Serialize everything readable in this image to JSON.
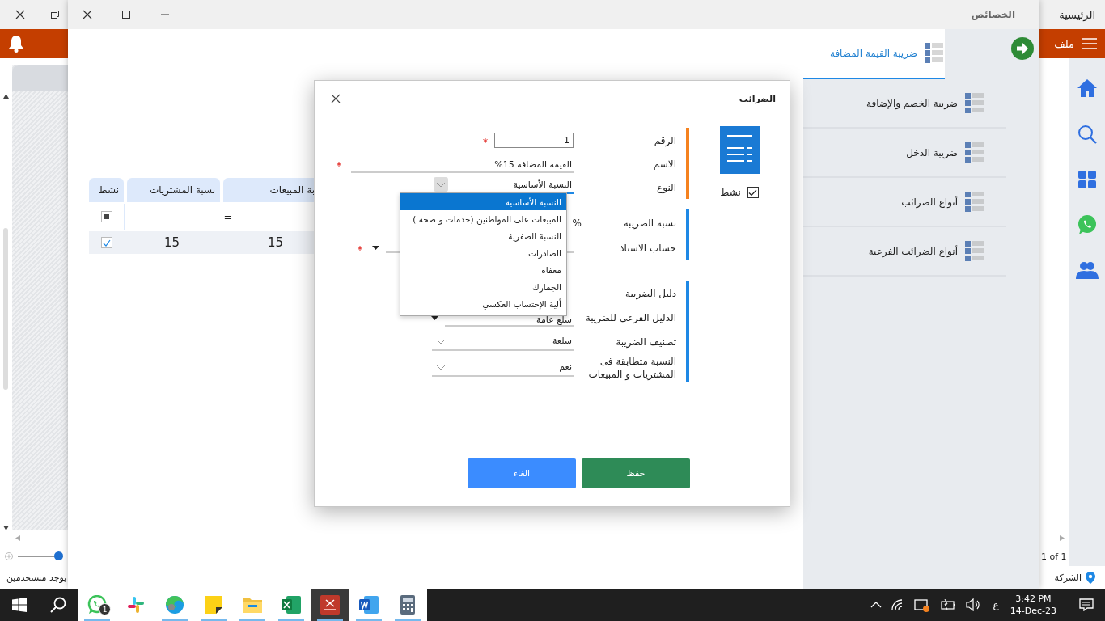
{
  "app": {
    "title": "الرئيسية",
    "menu_label": "ملف",
    "pager": "1 of 1",
    "status_company": "الشركة",
    "status_users": "يوجد مستخدمين",
    "zoom_slider": {
      "level": 0.9
    }
  },
  "properties_window": {
    "title": "الخصائص",
    "nav": [
      {
        "label": "ضريبة القيمة المضافة",
        "selected": true
      },
      {
        "label": "ضريبة الخصم والإضافة",
        "selected": false
      },
      {
        "label": "ضريبة الدخل",
        "selected": false
      },
      {
        "label": "أنواع الضرائب",
        "selected": false
      },
      {
        "label": "أنواع الضرائب الفرعية",
        "selected": false
      }
    ],
    "table": {
      "columns": [
        "بة المبيعات",
        "نسبة المشتريات",
        "نشط"
      ],
      "filter_row": {
        "indeterminate": true,
        "operator": "="
      },
      "rows": [
        {
          "cells": [
            "15",
            "15"
          ],
          "active": true
        }
      ]
    }
  },
  "dialog": {
    "title": "الضرائب",
    "active": true,
    "active_label": "نشط",
    "groups": [
      {
        "color": "#f5821f",
        "fields": [
          {
            "label": "الرقم",
            "kind": "number",
            "value": "1",
            "required": true
          },
          {
            "label": "الاسم",
            "kind": "text",
            "value": "القيمه المضافه 15%",
            "required": true
          },
          {
            "label": "النوع",
            "kind": "select",
            "value": "النسبة الأساسية",
            "expanded": true
          }
        ]
      },
      {
        "color": "#1e88e5",
        "fields": [
          {
            "label": "نسبة الضريبة",
            "kind": "percent",
            "unit": "%"
          },
          {
            "label": "حساب الاستاذ",
            "kind": "account",
            "required": true
          }
        ]
      },
      {
        "color": "#1e88e5",
        "fields": [
          {
            "label": "دليل الضريبة",
            "kind": "covered"
          },
          {
            "label": "الدليل الفرعي للضريبة",
            "kind": "combo",
            "value": "سلع عامة"
          },
          {
            "label": "تصنيف الضريبة",
            "kind": "select",
            "value": "سلعة",
            "expanded": false
          },
          {
            "label": "النسبة متطابقة فى المشتريات و المبيعات",
            "kind": "select",
            "value": "نعم",
            "expanded": false
          }
        ]
      }
    ],
    "type_options": [
      {
        "label": "النسبة الأساسية",
        "selected": true
      },
      {
        "label": "المبيعات على المواطنين (خدمات و صحة )",
        "selected": false
      },
      {
        "label": "النسبة الصفرية",
        "selected": false
      },
      {
        "label": "الصادرات",
        "selected": false
      },
      {
        "label": "معفاه",
        "selected": false
      },
      {
        "label": "الجمارك",
        "selected": false
      },
      {
        "label": "ألية الإحتساب العكسي",
        "selected": false
      }
    ],
    "buttons": [
      {
        "label": "حفظ",
        "kind": "save"
      },
      {
        "label": "الغاء",
        "kind": "cancel"
      }
    ]
  },
  "taskbar": {
    "apps": [
      {
        "kind": "whatsapp",
        "badge": "1",
        "running": true,
        "selected": false
      },
      {
        "kind": "slack",
        "running": false,
        "selected": false
      },
      {
        "kind": "edge",
        "running": true,
        "selected": false
      },
      {
        "kind": "notes",
        "running": true,
        "selected": false
      },
      {
        "kind": "folder",
        "running": true,
        "selected": false
      },
      {
        "kind": "excel",
        "running": true,
        "selected": false
      },
      {
        "kind": "one",
        "running": true,
        "selected": true
      },
      {
        "kind": "word",
        "running": true,
        "selected": false
      },
      {
        "kind": "calculator",
        "running": true,
        "selected": false
      }
    ],
    "language": "ع",
    "time": "3:42 PM",
    "date": "14-Dec-23"
  }
}
